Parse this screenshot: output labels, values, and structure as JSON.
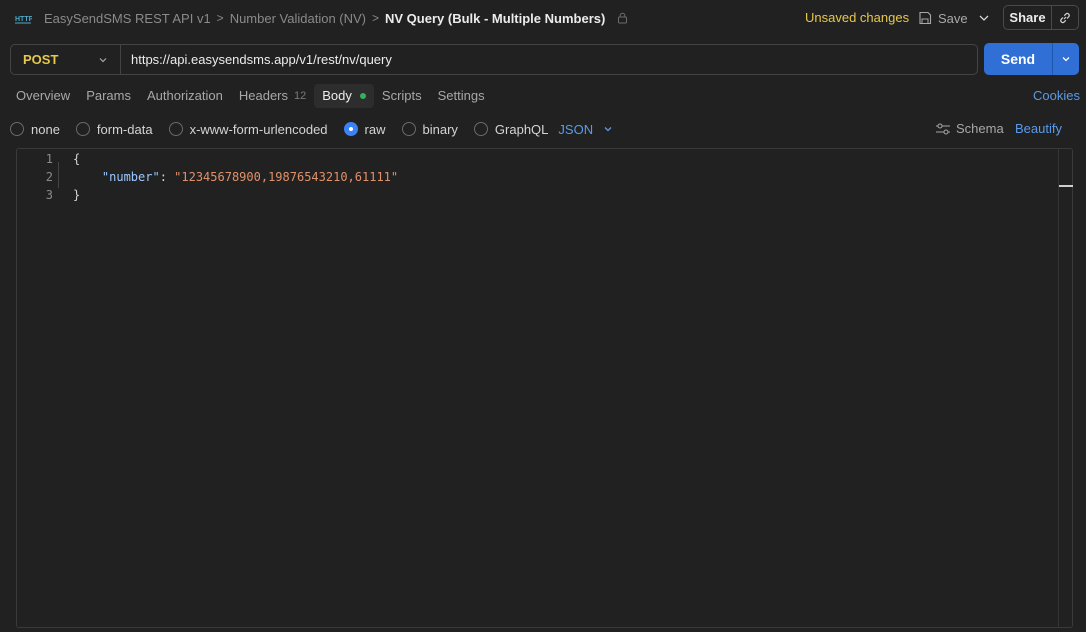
{
  "header": {
    "breadcrumb": [
      "EasySendSMS REST API v1",
      "Number Validation (NV)"
    ],
    "separator": ">",
    "current": "NV Query (Bulk - Multiple Numbers)",
    "unsaved": "Unsaved changes",
    "save_label": "Save",
    "share_label": "Share"
  },
  "request": {
    "method": "POST",
    "url": "https://api.easysendsms.app/v1/rest/nv/query",
    "send_label": "Send"
  },
  "tabs": [
    {
      "label": "Overview"
    },
    {
      "label": "Params"
    },
    {
      "label": "Authorization"
    },
    {
      "label": "Headers",
      "count": "12"
    },
    {
      "label": "Body",
      "active": true
    },
    {
      "label": "Scripts"
    },
    {
      "label": "Settings"
    }
  ],
  "cookies_label": "Cookies",
  "body_types": {
    "options": [
      "none",
      "form-data",
      "x-www-form-urlencoded",
      "raw",
      "binary",
      "GraphQL"
    ],
    "selected": "raw",
    "format": "JSON",
    "schema_label": "Schema",
    "beautify_label": "Beautify"
  },
  "editor": {
    "line_numbers": [
      "1",
      "2",
      "3"
    ],
    "open_brace": "{",
    "key": "\"number\"",
    "colon": ": ",
    "value": "\"12345678900,19876543210,61111\"",
    "close_brace": "}"
  },
  "colors": {
    "accent": "#2f6fd6",
    "method": "#e6c84a",
    "link": "#5a9be8",
    "status_dot": "#35b15c"
  }
}
